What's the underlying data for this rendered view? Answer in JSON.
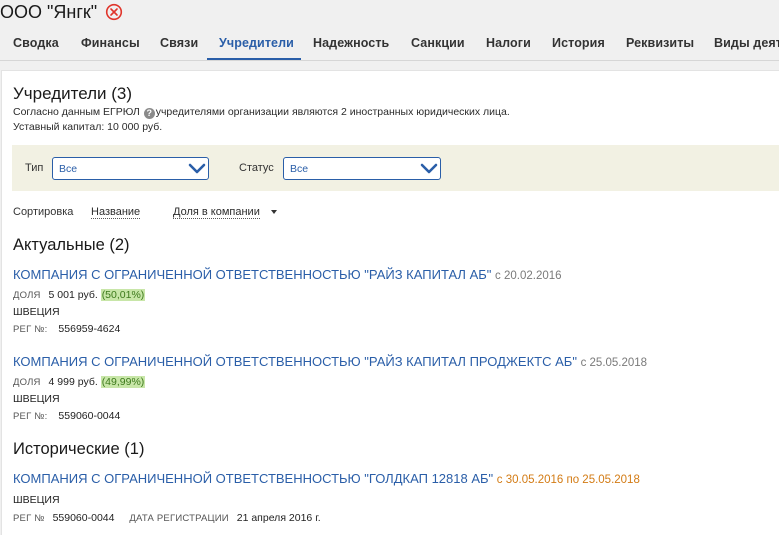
{
  "header": {
    "company_title": "ООО \"Янгк\""
  },
  "tabs": [
    {
      "label": "Сводка"
    },
    {
      "label": "Финансы"
    },
    {
      "label": "Связи"
    },
    {
      "label": "Учредители",
      "active": true
    },
    {
      "label": "Надежность"
    },
    {
      "label": "Санкции"
    },
    {
      "label": "Налоги"
    },
    {
      "label": "История"
    },
    {
      "label": "Реквизиты"
    },
    {
      "label": "Виды деят..."
    }
  ],
  "founders_section": {
    "title": "Учредители (3)",
    "info_before": "Согласно данным ЕГРЮЛ",
    "info_icon": "?",
    "info_after": "учредителями организации являются 2 иностранных юридических лица.",
    "capital": "Уставный капитал: 10 000 руб."
  },
  "filters": {
    "type_label": "Тип",
    "type_value": "Все",
    "status_label": "Статус",
    "status_value": "Все"
  },
  "sort": {
    "label": "Сортировка",
    "option_name": "Название",
    "option_share": "Доля в компании"
  },
  "current": {
    "title": "Актуальные (2)",
    "items": [
      {
        "name": "КОМПАНИЯ С ОГРАНИЧЕННОЙ ОТВЕТСТВЕННОСТЬЮ \"РАЙЗ КАПИТАЛ АБ\"",
        "date": "с 20.02.2016",
        "share_label": "ДОЛЯ",
        "share_value": "5 001 руб.",
        "share_percent": "(50,01%)",
        "country": "ШВЕЦИЯ",
        "reg_label": "РЕГ №:",
        "reg_value": "556959-4624"
      },
      {
        "name": "КОМПАНИЯ С ОГРАНИЧЕННОЙ ОТВЕТСТВЕННОСТЬЮ \"РАЙЗ КАПИТАЛ ПРОДЖЕКТС АБ\"",
        "date": "с 25.05.2018",
        "share_label": "ДОЛЯ",
        "share_value": "4 999 руб.",
        "share_percent": "(49,99%)",
        "country": "ШВЕЦИЯ",
        "reg_label": "РЕГ №:",
        "reg_value": "559060-0044"
      }
    ]
  },
  "historical": {
    "title": "Исторические (1)",
    "items": [
      {
        "name": "КОМПАНИЯ С ОГРАНИЧЕННОЙ ОТВЕТСТВЕННОСТЬЮ \"ГОЛДКАП 12818 АБ\"",
        "date": "с 30.05.2016 по 25.05.2018",
        "country": "ШВЕЦИЯ",
        "reg_label": "РЕГ №",
        "reg_value": "559060-0044",
        "regdate_label": "ДАТА РЕГИСТРАЦИИ",
        "regdate_value": "21 апреля 2016 г."
      }
    ]
  },
  "colors": {
    "accent": "#2a5ea8",
    "close": "#e0352b",
    "percent_bg": "#c8e6a8",
    "historical_date": "#d37b14",
    "filter_bg": "#f2f1e3"
  }
}
